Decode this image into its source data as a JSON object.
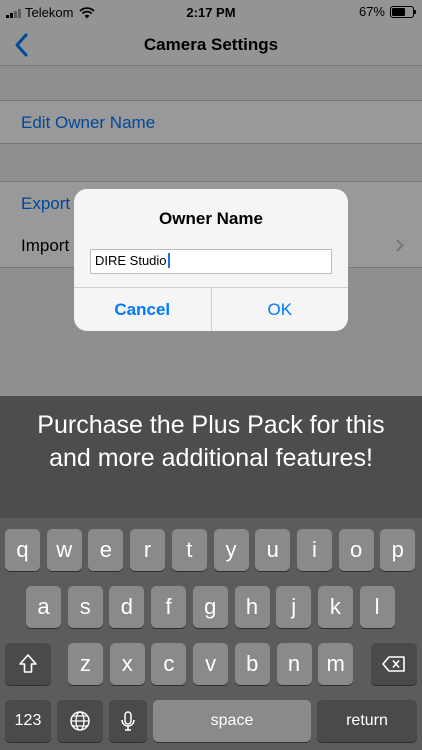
{
  "status": {
    "carrier": "Telekom",
    "time": "2:17 PM",
    "battery": "67%",
    "battery_level": 0.67
  },
  "nav": {
    "title": "Camera Settings",
    "back_icon": "chevron-left-icon"
  },
  "table": {
    "rows": [
      {
        "label": "Edit Owner Name"
      },
      {
        "label": "Export"
      },
      {
        "label": "Import"
      }
    ]
  },
  "alert": {
    "title": "Owner Name",
    "input_value": "DIRE Studio",
    "cancel_label": "Cancel",
    "ok_label": "OK"
  },
  "promo": {
    "text": "Purchase the Plus Pack for this and more additional features!"
  },
  "keyboard": {
    "row1": [
      "q",
      "w",
      "e",
      "r",
      "t",
      "y",
      "u",
      "i",
      "o",
      "p"
    ],
    "row2": [
      "a",
      "s",
      "d",
      "f",
      "g",
      "h",
      "j",
      "k",
      "l"
    ],
    "row3": [
      "z",
      "x",
      "c",
      "v",
      "b",
      "n",
      "m"
    ],
    "numbers_label": "123",
    "space_label": "space",
    "return_label": "return"
  },
  "colors": {
    "accent": "#007aff",
    "promo_bg": "#4d4d4d",
    "keyboard_bg": "#5c5c5e"
  }
}
